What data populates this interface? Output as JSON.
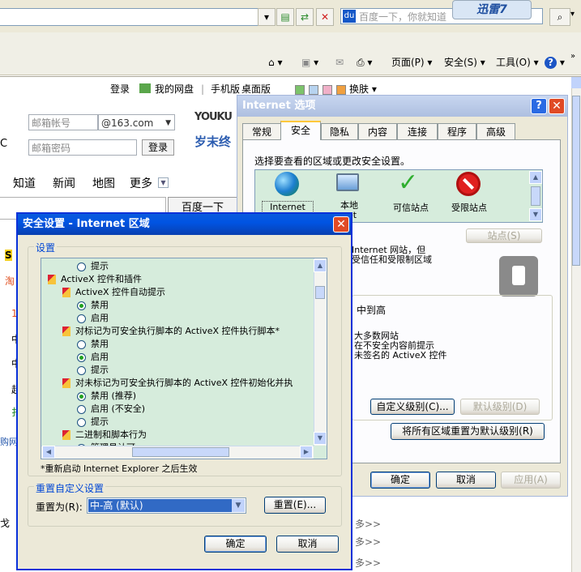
{
  "browser": {
    "search_placeholder": "百度一下，你就知道",
    "thunder_label": "迅雷7",
    "commands": {
      "page": "页面(P)",
      "safety": "安全(S)",
      "tools": "工具(O)",
      "help": "?"
    }
  },
  "page": {
    "topnav": {
      "login": "登录",
      "netdisk": "我的网盘",
      "mobile": "手机版",
      "desktop": "桌面版",
      "skin": "换肤"
    },
    "login": {
      "account_placeholder": "邮箱帐号",
      "domain": "@163.com",
      "password_placeholder": "邮箱密码",
      "login_button": "登录"
    },
    "youku_text": "YOUKU",
    "youku_sub": "岁末终",
    "nav": [
      "知道",
      "新闻",
      "地图",
      "更多"
    ],
    "search_button": "百度一下",
    "left_fragments": [
      "C",
      "S",
      "淘",
      "1",
      "中",
      "中",
      "超",
      "扌",
      "购网",
      "戈"
    ],
    "more_links": [
      "多>>",
      "多>>",
      "多>>"
    ]
  },
  "ie_options": {
    "title": "Internet 选项",
    "tabs": [
      "常规",
      "安全",
      "隐私",
      "内容",
      "连接",
      "程序",
      "高级"
    ],
    "active_tab": "安全",
    "zone_prompt": "选择要查看的区域或更改安全设置。",
    "zones": [
      {
        "label": "Internet",
        "icon": "globe-icon"
      },
      {
        "label": "本地",
        "sub": "net",
        "icon": "computer-icon"
      },
      {
        "label": "可信站点",
        "icon": "check-icon"
      },
      {
        "label": "受限站点",
        "icon": "restricted-icon"
      }
    ],
    "sites_button": "站点(S)",
    "zone_desc_1": "Internet 网站，但",
    "zone_desc_2": "受信任和受限制区域",
    "level_title": "中到高",
    "level_lines": [
      "大多数网站",
      "在不安全内容前提示",
      "未签名的 ActiveX 控件"
    ],
    "custom_level_button": "自定义级别(C)...",
    "default_level_button": "默认级别(D)",
    "reset_all_button": "将所有区域重置为默认级别(R)",
    "ok": "确定",
    "cancel": "取消",
    "apply": "应用(A)"
  },
  "security_settings": {
    "title": "安全设置 - Internet 区域",
    "settings_group": "设置",
    "tree": [
      {
        "kind": "radio",
        "level": 2,
        "label": "提示",
        "checked": false
      },
      {
        "kind": "folder",
        "level": 0,
        "label": "ActiveX 控件和插件"
      },
      {
        "kind": "folder",
        "level": 1,
        "label": "ActiveX 控件自动提示"
      },
      {
        "kind": "radio",
        "level": 2,
        "label": "禁用",
        "checked": true
      },
      {
        "kind": "radio",
        "level": 2,
        "label": "启用",
        "checked": false
      },
      {
        "kind": "folder",
        "level": 1,
        "label": "对标记为可安全执行脚本的 ActiveX 控件执行脚本*"
      },
      {
        "kind": "radio",
        "level": 2,
        "label": "禁用",
        "checked": false
      },
      {
        "kind": "radio",
        "level": 2,
        "label": "启用",
        "checked": true
      },
      {
        "kind": "radio",
        "level": 2,
        "label": "提示",
        "checked": false
      },
      {
        "kind": "folder",
        "level": 1,
        "label": "对未标记为可安全执行脚本的 ActiveX 控件初始化并执"
      },
      {
        "kind": "radio",
        "level": 2,
        "label": "禁用 (推荐)",
        "checked": true
      },
      {
        "kind": "radio",
        "level": 2,
        "label": "启用 (不安全)",
        "checked": false
      },
      {
        "kind": "radio",
        "level": 2,
        "label": "提示",
        "checked": false
      },
      {
        "kind": "folder",
        "level": 1,
        "label": "二进制和脚本行为"
      },
      {
        "kind": "radio",
        "level": 2,
        "label": "管理员认可",
        "checked": false
      }
    ],
    "restart_note": "*重新启动 Internet Explorer 之后生效",
    "reset_group": "重置自定义设置",
    "reset_to_label": "重置为(R):",
    "reset_to_value": "中-高 (默认)",
    "reset_button": "重置(E)...",
    "ok": "确定",
    "cancel": "取消"
  }
}
